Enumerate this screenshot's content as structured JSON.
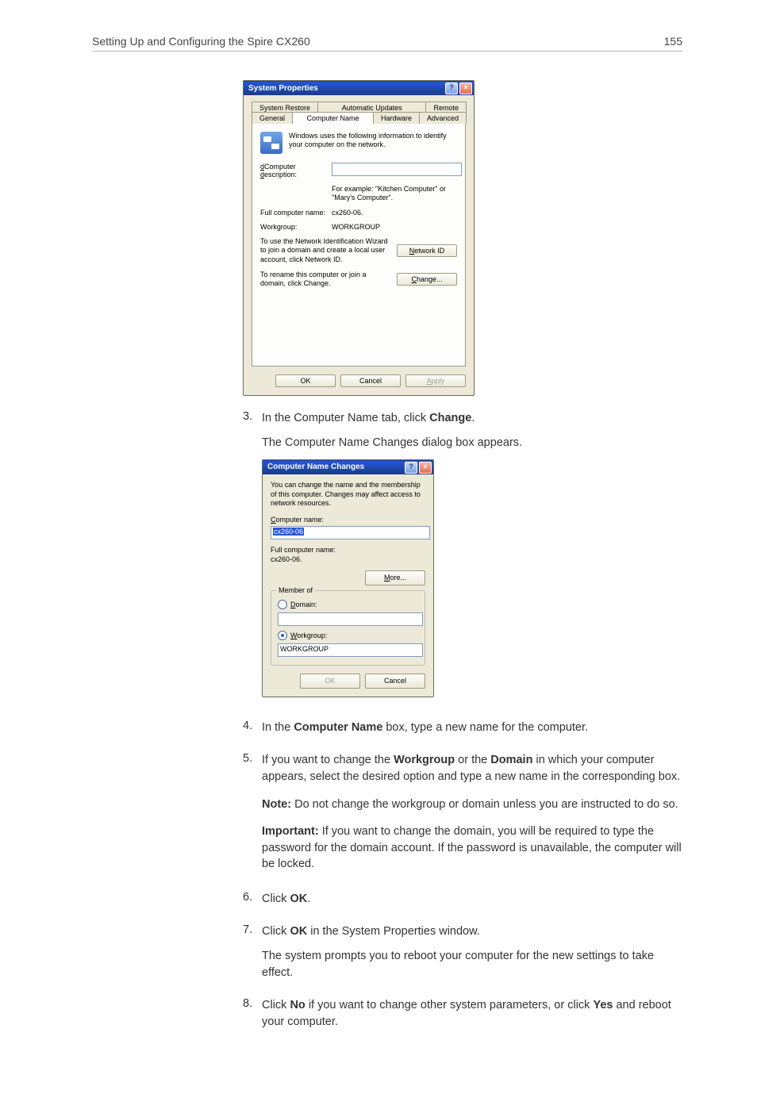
{
  "header": {
    "title": "Setting Up and Configuring the Spire CX260",
    "page_number": "155"
  },
  "dialog1": {
    "title": "System Properties",
    "tabs_row2": [
      "System Restore",
      "Automatic Updates",
      "Remote"
    ],
    "tabs_row1": [
      "General",
      "Computer Name",
      "Hardware",
      "Advanced"
    ],
    "info_text": "Windows uses the following information to identify your computer on the network.",
    "desc_label": "Computer description:",
    "desc_hint": "For example: \"Kitchen Computer\" or \"Mary's Computer\".",
    "fullname_label": "Full computer name:",
    "fullname_value": "cx260-06.",
    "workgroup_label": "Workgroup:",
    "workgroup_value": "WORKGROUP",
    "wizard_text": "To use the Network Identification Wizard to join a domain and create a local user account, click Network ID.",
    "network_id_btn": "Network ID",
    "rename_text": "To rename this computer or join a domain, click Change.",
    "change_btn": "Change...",
    "ok": "OK",
    "cancel": "Cancel",
    "apply": "Apply"
  },
  "step3": {
    "num": "3.",
    "text_a": "In the Computer Name tab, click ",
    "text_b": "Change",
    "text_c": ".",
    "result": "The Computer Name Changes dialog box appears."
  },
  "dialog2": {
    "title": "Computer Name Changes",
    "intro": "You can change the name and the membership of this computer. Changes may affect access to network resources.",
    "cname_label": "Computer name:",
    "cname_value": "cx260-06",
    "fullname_label": "Full computer name:",
    "fullname_value": "cx260-06.",
    "more_btn": "More...",
    "member_title": "Member of",
    "domain_label": "Domain:",
    "workgroup_label": "Workgroup:",
    "workgroup_value": "WORKGROUP",
    "ok": "OK",
    "cancel": "Cancel"
  },
  "step4": {
    "num": "4.",
    "a": "In the ",
    "b": "Computer Name",
    "c": " box, type a new name for the computer."
  },
  "step5": {
    "num": "5.",
    "a": "If you want to change the ",
    "b": "Workgroup",
    "c": " or the ",
    "d": "Domain",
    "e": " in which your computer appears, select the desired option and type a new name in the corresponding box."
  },
  "note": {
    "label": "Note:",
    "text": "  Do not change the workgroup or domain unless you are instructed to do so."
  },
  "important": {
    "label": "Important:",
    "text": "  If you want to change the domain, you will be required to type the password for the domain account. If the password is unavailable, the computer will be locked."
  },
  "step6": {
    "num": "6.",
    "a": "Click ",
    "b": "OK",
    "c": "."
  },
  "step7": {
    "num": "7.",
    "a": "Click ",
    "b": "OK",
    "c": " in the System Properties window.",
    "result": "The system prompts you to reboot your computer for the new settings to take effect."
  },
  "step8": {
    "num": "8.",
    "a": "Click ",
    "b": "No",
    "c": " if you want to change other system parameters, or click ",
    "d": "Yes",
    "e": " and reboot your computer."
  }
}
